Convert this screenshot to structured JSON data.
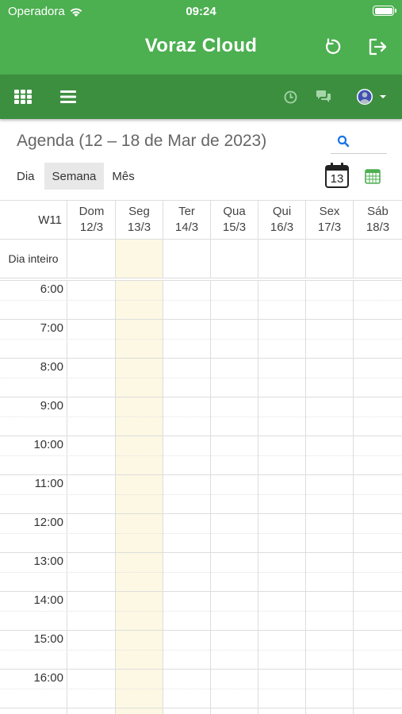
{
  "status_bar": {
    "carrier": "Operadora",
    "time": "09:24"
  },
  "header": {
    "title": "Voraz Cloud",
    "refresh_icon": "refresh-icon",
    "logout_icon": "logout-icon"
  },
  "toolbar": {
    "apps_icon": "grid-icon",
    "menu_icon": "hamburger-icon",
    "clock_icon": "clock-icon",
    "chat_icon": "chat-icon",
    "user_icon": "user-avatar-icon"
  },
  "agenda": {
    "title": "Agenda (12 – 18 de Mar de 2023)",
    "views": [
      "Dia",
      "Semana",
      "Mês"
    ],
    "active_view": "Semana",
    "today_day": "13"
  },
  "calendar": {
    "week_label": "W11",
    "allday_label": "Dia inteiro",
    "days": [
      {
        "name": "Dom",
        "date": "12/3"
      },
      {
        "name": "Seg",
        "date": "13/3"
      },
      {
        "name": "Ter",
        "date": "14/3"
      },
      {
        "name": "Qua",
        "date": "15/3"
      },
      {
        "name": "Qui",
        "date": "16/3"
      },
      {
        "name": "Sex",
        "date": "17/3"
      },
      {
        "name": "Sáb",
        "date": "18/3"
      }
    ],
    "hours": [
      "6:00",
      "7:00",
      "8:00",
      "9:00",
      "10:00",
      "11:00",
      "12:00",
      "13:00",
      "14:00",
      "15:00",
      "16:00"
    ],
    "highlight_color": "#fcf8e3"
  },
  "colors": {
    "header": "#4caf50",
    "toolbar": "#3d8f40",
    "accent": "#1a73e8"
  }
}
